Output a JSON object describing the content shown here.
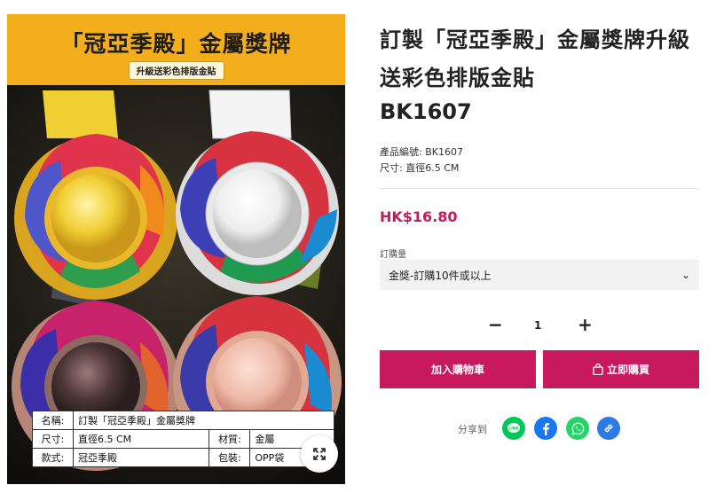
{
  "product": {
    "title": "訂製「冠亞季殿」金屬獎牌升級送彩色排版金貼",
    "code_heading": "BK1607",
    "code_line": "產品編號: BK1607",
    "size_line": "尺寸: 直徑6.5 CM",
    "price": "HK$16.80"
  },
  "image": {
    "banner_title": "「冠亞季殿」金屬獎牌",
    "banner_subtitle": "升級送彩色排版金貼",
    "spec_table": {
      "name_key": "名稱:",
      "name_val": "訂製「冠亞季殿」金屬獎牌",
      "size_key": "尺寸:",
      "size_val": "直徑6.5 CM",
      "material_key": "材質:",
      "material_val": "金屬",
      "style_key": "款式:",
      "style_val": "冠亞季殿",
      "pack_key": "包裝:",
      "pack_val": "OPP袋"
    },
    "expand_icon": "expand-icon"
  },
  "order": {
    "qty_label": "訂購量",
    "qty_option": "金獎-訂購10件或以上",
    "minus": "−",
    "quantity": "1",
    "plus": "+"
  },
  "buttons": {
    "add_to_cart": "加入購物車",
    "buy_now": "立即購買"
  },
  "share": {
    "label": "分享到",
    "icons": [
      "line-icon",
      "facebook-icon",
      "whatsapp-icon",
      "link-icon"
    ]
  },
  "colors": {
    "accent": "#c8185e",
    "banner": "#f4ad1b"
  }
}
